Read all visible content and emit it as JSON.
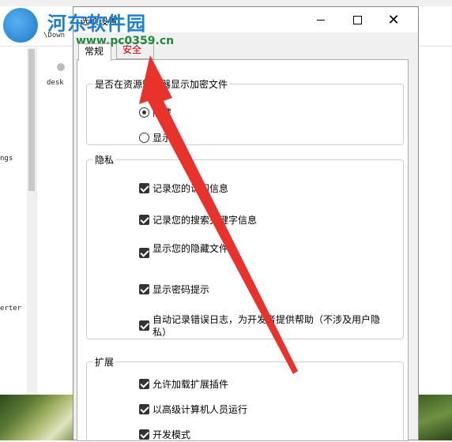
{
  "background": {
    "address_text": "\\Down",
    "col_item": "desk",
    "left_item_1": "ngs",
    "left_item_2": "erter"
  },
  "dialog": {
    "title": "选项设置",
    "close_glyph": "✕",
    "tabs": [
      {
        "label": "常规"
      },
      {
        "label": "安全"
      }
    ],
    "groups": {
      "explorer": {
        "legend": "是否在资源管理器显示加密文件",
        "options": [
          {
            "label": "隐藏",
            "selected": true
          },
          {
            "label": "显示",
            "selected": false
          }
        ]
      },
      "privacy": {
        "legend": "隐私",
        "options": [
          {
            "label": "记录您的访问信息",
            "checked": true
          },
          {
            "label": "记录您的搜索关键字信息",
            "checked": true
          },
          {
            "label": "显示您的隐藏文件",
            "checked": true
          },
          {
            "label": "显示密码提示",
            "checked": true
          },
          {
            "label": "自动记录错误日志，为开发者提供帮助（不涉及用户隐私）",
            "checked": true
          }
        ]
      },
      "extension": {
        "legend": "扩展",
        "options": [
          {
            "label": "允许加载扩展插件",
            "checked": true
          },
          {
            "label": "以高级计算机人员运行",
            "checked": true
          },
          {
            "label": "开发模式",
            "checked": true
          }
        ]
      }
    }
  },
  "watermark": {
    "name": "河东软件园",
    "url": "www.pc0359.cn"
  },
  "colors": {
    "annotation_arrow": "#e8322b",
    "security_tab_text": "#c00000"
  }
}
